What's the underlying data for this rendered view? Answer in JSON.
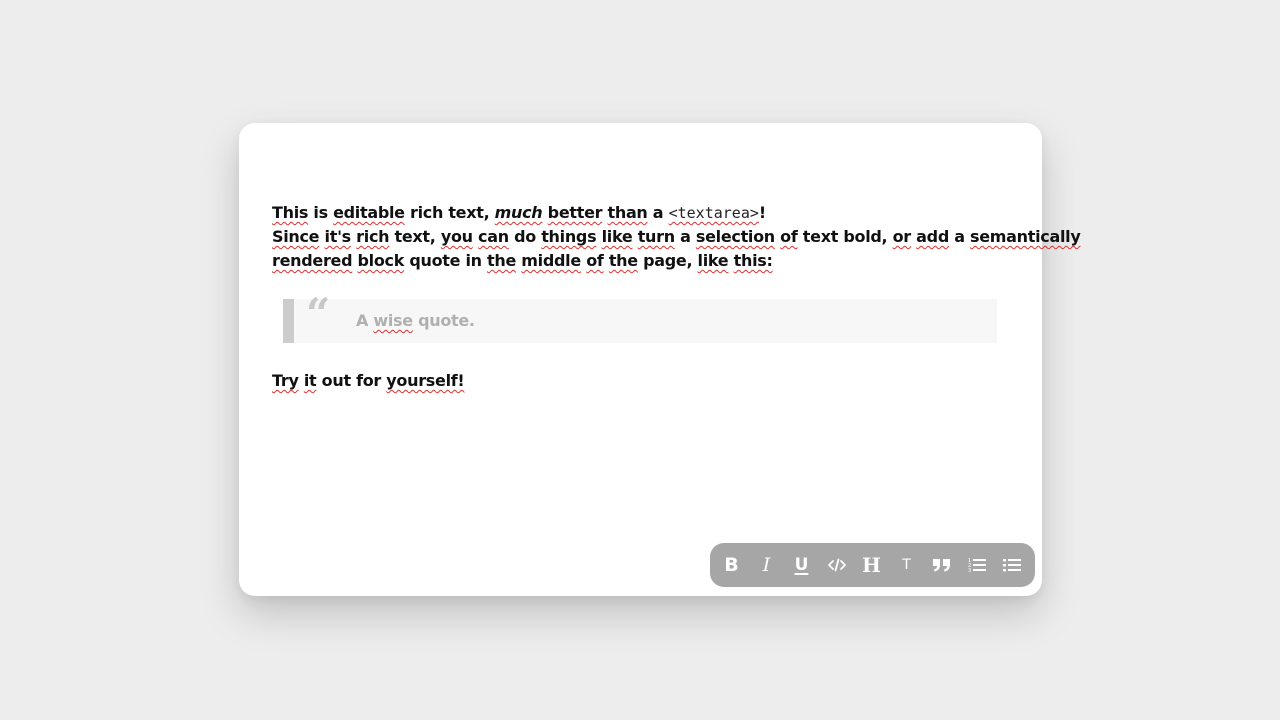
{
  "editor": {
    "line1": {
      "p1": "This",
      "p2": " is ",
      "p3": "editable",
      "p4": " ",
      "p5": "rich",
      "p6": " text, ",
      "p7": "much",
      "p8": " ",
      "p9": "better",
      "p10": " ",
      "p11": "than",
      "p12": " a ",
      "p13": "<textarea>",
      "p14": "!"
    },
    "line2": {
      "p1": "Since",
      "p2": " ",
      "p3": "it's",
      "p4": " ",
      "p5": "rich",
      "p6": " text, ",
      "p7": "you",
      "p8": " ",
      "p9": "can",
      "p10": " do ",
      "p11": "things",
      "p12": " ",
      "p13": "like",
      "p14": " ",
      "p15": "turn",
      "p16": " a ",
      "p17": "selection",
      "p18": " ",
      "p19": "of",
      "p20": " text ",
      "p21": "bold",
      "p22": ", ",
      "p23": "or",
      "p24": " ",
      "p25": "add",
      "p26": " a ",
      "p27": "semantically"
    },
    "line3": {
      "p1": "rendered",
      "p2": " ",
      "p3": "block",
      "p4": " quote in ",
      "p5": "the",
      "p6": " ",
      "p7": "middle",
      "p8": " ",
      "p9": "of",
      "p10": " ",
      "p11": "the",
      "p12": " page, ",
      "p13": "like",
      "p14": " ",
      "p15": "this:"
    },
    "quote": {
      "mark": "“",
      "p1": "A ",
      "p2": "wise",
      "p3": " quote."
    },
    "final": {
      "p1": "Try",
      "p2": " ",
      "p3": "it",
      "p4": " out for ",
      "p5": "yourself!"
    }
  },
  "toolbar": {
    "bold_label": "B",
    "italic_label": "I",
    "underline_label": "U",
    "heading_label": "H",
    "text_label": "T",
    "icons": [
      "bold-icon",
      "italic-icon",
      "underline-icon",
      "code-icon",
      "heading-icon",
      "text-icon",
      "quote-icon",
      "numbered-list-icon",
      "bulleted-list-icon"
    ]
  },
  "colors": {
    "background": "#ededed",
    "card": "#ffffff",
    "text": "#111111",
    "quote_bar": "#cccccc",
    "quote_bg": "#f7f7f7",
    "quote_text": "#b0b0b0",
    "toolbar": "#a6a6a6",
    "spellcheck": "#e03030"
  }
}
